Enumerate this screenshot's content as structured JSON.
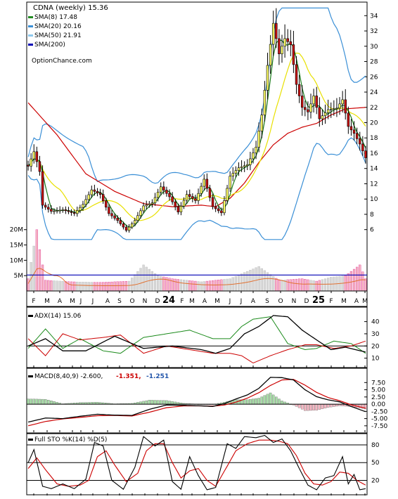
{
  "chart_data": [
    {
      "type": "candlestick",
      "panel": "price",
      "title": "CDNA (weekly) 15.36",
      "watermark": "OptionChance.com",
      "legend": [
        {
          "label": "SMA(8) 17.48",
          "color": "#228b22"
        },
        {
          "label": "SMA(20) 20.16",
          "color": "#3a8fd6"
        },
        {
          "label": "SMA(50) 21.91",
          "color": "#8ec9ee"
        },
        {
          "label": "SMA(200)",
          "color": "#0000b4"
        }
      ],
      "legend_placement": "top-left",
      "y_ticks": [
        6,
        8,
        10,
        12,
        14,
        16,
        18,
        20,
        22,
        24,
        26,
        28,
        30,
        32,
        34
      ],
      "ylim": [
        4.5,
        35.5
      ],
      "x_labels": [
        "F",
        "M",
        "A",
        "M",
        "J",
        "J",
        "A",
        "S",
        "O",
        "N",
        "D",
        "24",
        "F",
        "M",
        "A",
        "M",
        "J",
        "J",
        "A",
        "S",
        "O",
        "N",
        "D",
        "25",
        "F",
        "M",
        "A",
        "M"
      ],
      "volume_ticks": [
        "20M",
        "15M",
        "10M",
        "5M"
      ],
      "volume_ylim": [
        0,
        22
      ],
      "volume_avg_line": 5.2,
      "weeks": 118,
      "close_anchors": [
        [
          0,
          14.3
        ],
        [
          2,
          16.2
        ],
        [
          4,
          13.6
        ],
        [
          5,
          9.2
        ],
        [
          8,
          8.4
        ],
        [
          12,
          8.6
        ],
        [
          16,
          8.1
        ],
        [
          19,
          9.3
        ],
        [
          22,
          11.2
        ],
        [
          25,
          10.6
        ],
        [
          28,
          8.1
        ],
        [
          31,
          7.2
        ],
        [
          34,
          5.9
        ],
        [
          37,
          7.2
        ],
        [
          40,
          9.1
        ],
        [
          43,
          9.5
        ],
        [
          46,
          11.6
        ],
        [
          49,
          10.3
        ],
        [
          52,
          8.3
        ],
        [
          55,
          10.6
        ],
        [
          58,
          9.8
        ],
        [
          61,
          12.6
        ],
        [
          64,
          9.0
        ],
        [
          67,
          8.2
        ],
        [
          70,
          13.0
        ],
        [
          73,
          14.1
        ],
        [
          76,
          14.5
        ],
        [
          79,
          16.8
        ],
        [
          81,
          21.0
        ],
        [
          83,
          27.5
        ],
        [
          85,
          33.0
        ],
        [
          87,
          29.0
        ],
        [
          89,
          31.0
        ],
        [
          91,
          30.2
        ],
        [
          93,
          25.0
        ],
        [
          95,
          22.0
        ],
        [
          97,
          21.4
        ],
        [
          99,
          23.5
        ],
        [
          101,
          20.5
        ],
        [
          104,
          21.7
        ],
        [
          107,
          21.9
        ],
        [
          109,
          23.0
        ],
        [
          111,
          19.5
        ],
        [
          113,
          18.6
        ],
        [
          115,
          17.2
        ],
        [
          117,
          15.4
        ]
      ],
      "volume_anchors": [
        [
          0,
          4.0
        ],
        [
          3,
          20.0
        ],
        [
          4,
          13.5
        ],
        [
          6,
          3.5
        ],
        [
          15,
          3.0
        ],
        [
          25,
          2.8
        ],
        [
          35,
          3.2
        ],
        [
          40,
          8.5
        ],
        [
          45,
          5.0
        ],
        [
          50,
          4.0
        ],
        [
          60,
          3.0
        ],
        [
          70,
          4.0
        ],
        [
          75,
          6.0
        ],
        [
          80,
          8.0
        ],
        [
          83,
          6.0
        ],
        [
          87,
          3.5
        ],
        [
          95,
          4.0
        ],
        [
          100,
          3.2
        ],
        [
          105,
          4.5
        ],
        [
          110,
          5.0
        ],
        [
          115,
          8.5
        ],
        [
          117,
          4.0
        ]
      ],
      "sma200_anchors": [
        [
          0,
          22.6
        ],
        [
          10,
          18.4
        ],
        [
          20,
          13.3
        ],
        [
          30,
          11.0
        ],
        [
          40,
          9.4
        ],
        [
          50,
          9.0
        ],
        [
          60,
          9.2
        ],
        [
          65,
          9.0
        ],
        [
          70,
          10.1
        ],
        [
          75,
          12.1
        ],
        [
          80,
          14.8
        ],
        [
          85,
          17.1
        ],
        [
          90,
          18.6
        ],
        [
          95,
          19.4
        ],
        [
          100,
          19.9
        ],
        [
          105,
          21.0
        ],
        [
          110,
          21.8
        ],
        [
          117,
          22.0
        ]
      ]
    },
    {
      "type": "line",
      "panel": "adx",
      "title": "ADX(14) 15.06",
      "y_ticks": [
        10,
        20,
        30,
        40
      ],
      "ylim": [
        4,
        49
      ],
      "adx_anchors": [
        [
          0,
          20
        ],
        [
          6,
          26
        ],
        [
          12,
          16
        ],
        [
          20,
          16
        ],
        [
          30,
          28
        ],
        [
          40,
          18
        ],
        [
          50,
          20
        ],
        [
          60,
          17
        ],
        [
          65,
          14
        ],
        [
          70,
          18
        ],
        [
          75,
          30
        ],
        [
          80,
          36
        ],
        [
          85,
          45
        ],
        [
          90,
          44
        ],
        [
          95,
          33
        ],
        [
          100,
          25
        ],
        [
          105,
          17
        ],
        [
          110,
          19
        ],
        [
          117,
          15
        ]
      ],
      "plus_di_anchors": [
        [
          0,
          18
        ],
        [
          6,
          34
        ],
        [
          12,
          18
        ],
        [
          18,
          26
        ],
        [
          26,
          16
        ],
        [
          32,
          14
        ],
        [
          40,
          27
        ],
        [
          48,
          30
        ],
        [
          56,
          33
        ],
        [
          64,
          26
        ],
        [
          70,
          26
        ],
        [
          74,
          36
        ],
        [
          78,
          42
        ],
        [
          84,
          44
        ],
        [
          90,
          22
        ],
        [
          96,
          17
        ],
        [
          100,
          18
        ],
        [
          106,
          24
        ],
        [
          112,
          22
        ],
        [
          117,
          14
        ]
      ],
      "minus_di_anchors": [
        [
          0,
          26
        ],
        [
          6,
          12
        ],
        [
          12,
          30
        ],
        [
          18,
          25
        ],
        [
          26,
          27
        ],
        [
          32,
          29
        ],
        [
          40,
          14
        ],
        [
          48,
          20
        ],
        [
          56,
          17
        ],
        [
          64,
          14
        ],
        [
          70,
          14
        ],
        [
          74,
          12
        ],
        [
          78,
          6
        ],
        [
          84,
          12
        ],
        [
          90,
          17
        ],
        [
          96,
          21
        ],
        [
          100,
          21
        ],
        [
          106,
          18
        ],
        [
          112,
          20
        ],
        [
          117,
          24
        ]
      ]
    },
    {
      "type": "line",
      "panel": "macd",
      "title": "MACD(8,40,9) -2.600,",
      "values_labels": [
        {
          "text": "-1.351,",
          "color": "#cc0000"
        },
        {
          "text": "-1.251",
          "color": "#2255aa"
        }
      ],
      "y_ticks": [
        "7.50",
        "5.00",
        "2.50",
        "0.00",
        "-2.50",
        "-5.00",
        "-7.50"
      ],
      "ylim": [
        -9,
        10.5
      ],
      "macd_anchors": [
        [
          0,
          -6.2
        ],
        [
          6,
          -4.8
        ],
        [
          12,
          -5.0
        ],
        [
          18,
          -4.2
        ],
        [
          24,
          -3.5
        ],
        [
          30,
          -3.8
        ],
        [
          36,
          -3.9
        ],
        [
          42,
          -1.8
        ],
        [
          48,
          -0.3
        ],
        [
          54,
          -0.4
        ],
        [
          60,
          -0.6
        ],
        [
          64,
          -0.8
        ],
        [
          68,
          0.2
        ],
        [
          72,
          1.8
        ],
        [
          76,
          3.2
        ],
        [
          80,
          5.5
        ],
        [
          84,
          9.3
        ],
        [
          88,
          9.2
        ],
        [
          92,
          8.4
        ],
        [
          96,
          5.0
        ],
        [
          100,
          2.6
        ],
        [
          104,
          1.5
        ],
        [
          108,
          0.8
        ],
        [
          112,
          -0.8
        ],
        [
          117,
          -2.6
        ]
      ],
      "signal_anchors": [
        [
          0,
          -7.5
        ],
        [
          6,
          -6.0
        ],
        [
          12,
          -5.1
        ],
        [
          18,
          -4.6
        ],
        [
          24,
          -4.0
        ],
        [
          30,
          -3.9
        ],
        [
          36,
          -4.1
        ],
        [
          42,
          -2.8
        ],
        [
          48,
          -1.2
        ],
        [
          54,
          -0.6
        ],
        [
          60,
          -0.6
        ],
        [
          64,
          -0.7
        ],
        [
          68,
          -0.3
        ],
        [
          72,
          0.7
        ],
        [
          76,
          2.1
        ],
        [
          80,
          4.0
        ],
        [
          84,
          6.5
        ],
        [
          88,
          8.4
        ],
        [
          92,
          8.6
        ],
        [
          96,
          6.6
        ],
        [
          100,
          4.1
        ],
        [
          104,
          2.3
        ],
        [
          108,
          1.2
        ],
        [
          112,
          -0.2
        ],
        [
          117,
          -1.4
        ]
      ]
    },
    {
      "type": "line",
      "panel": "stochastic",
      "title": "Full STO %K(14) %D(5)",
      "y_ticks": [
        20,
        50,
        80
      ],
      "ylim": [
        -2,
        93
      ],
      "k_anchors": [
        [
          0,
          50
        ],
        [
          2,
          72
        ],
        [
          5,
          10
        ],
        [
          8,
          6
        ],
        [
          12,
          14
        ],
        [
          16,
          6
        ],
        [
          20,
          22
        ],
        [
          23,
          84
        ],
        [
          26,
          78
        ],
        [
          29,
          20
        ],
        [
          33,
          5
        ],
        [
          37,
          42
        ],
        [
          40,
          94
        ],
        [
          44,
          78
        ],
        [
          47,
          88
        ],
        [
          50,
          18
        ],
        [
          53,
          5
        ],
        [
          56,
          60
        ],
        [
          59,
          28
        ],
        [
          62,
          4
        ],
        [
          65,
          8
        ],
        [
          69,
          82
        ],
        [
          72,
          74
        ],
        [
          75,
          94
        ],
        [
          79,
          92
        ],
        [
          82,
          96
        ],
        [
          85,
          84
        ],
        [
          88,
          90
        ],
        [
          91,
          70
        ],
        [
          94,
          40
        ],
        [
          97,
          12
        ],
        [
          100,
          4
        ],
        [
          103,
          24
        ],
        [
          106,
          28
        ],
        [
          109,
          60
        ],
        [
          111,
          14
        ],
        [
          113,
          30
        ],
        [
          115,
          4
        ],
        [
          117,
          6
        ]
      ],
      "d_anchors": [
        [
          0,
          40
        ],
        [
          3,
          58
        ],
        [
          6,
          38
        ],
        [
          10,
          14
        ],
        [
          14,
          10
        ],
        [
          18,
          12
        ],
        [
          21,
          20
        ],
        [
          24,
          60
        ],
        [
          27,
          70
        ],
        [
          30,
          46
        ],
        [
          34,
          18
        ],
        [
          38,
          32
        ],
        [
          41,
          70
        ],
        [
          44,
          82
        ],
        [
          47,
          82
        ],
        [
          50,
          50
        ],
        [
          53,
          24
        ],
        [
          56,
          36
        ],
        [
          59,
          40
        ],
        [
          62,
          20
        ],
        [
          65,
          10
        ],
        [
          69,
          44
        ],
        [
          72,
          70
        ],
        [
          76,
          82
        ],
        [
          80,
          88
        ],
        [
          84,
          88
        ],
        [
          87,
          86
        ],
        [
          90,
          82
        ],
        [
          93,
          62
        ],
        [
          96,
          32
        ],
        [
          99,
          14
        ],
        [
          102,
          12
        ],
        [
          105,
          18
        ],
        [
          108,
          34
        ],
        [
          111,
          32
        ],
        [
          114,
          20
        ],
        [
          117,
          12
        ]
      ]
    }
  ]
}
